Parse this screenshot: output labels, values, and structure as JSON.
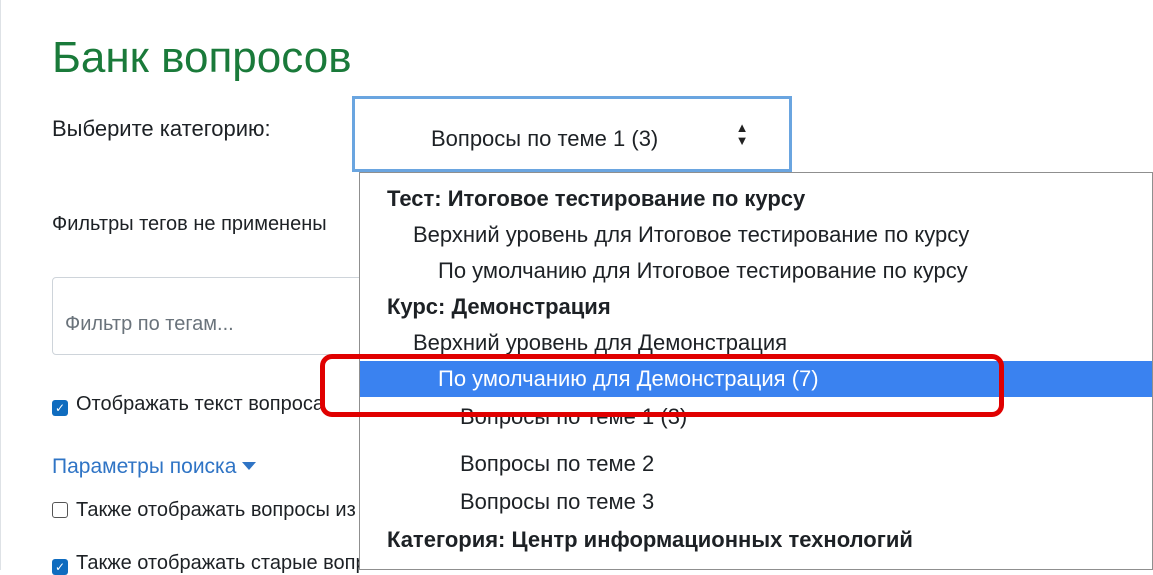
{
  "page": {
    "title": "Банк вопросов",
    "category_label": "Выберите категорию:",
    "category_select": {
      "value": "Вопросы по теме 1 (3)",
      "arrows_glyph": "⇕"
    },
    "tag_filters_note": "Фильтры тегов не применены",
    "tag_filter": {
      "placeholder": "Фильтр по тегам..."
    },
    "show_question_text": {
      "label": "Отображать текст вопроса",
      "checked": true
    },
    "search_options_link": "Параметры поиска",
    "also_show_subcategories": {
      "label": "Также отображать вопросы из подкатегорий",
      "checked": false
    },
    "also_show_old": {
      "label": "Также отображать старые вопросы",
      "checked": true
    }
  },
  "dropdown": {
    "options": [
      {
        "label": "Тест: Итоговое тестирование по курсу",
        "kind": "group"
      },
      {
        "label": "Верхний уровень для Итоговое тестирование по курсу",
        "kind": "option"
      },
      {
        "label": "По умолчанию для Итоговое тестирование по курсу",
        "kind": "option"
      },
      {
        "label": "Курс: Демонстрация",
        "kind": "group"
      },
      {
        "label": "Верхний уровень для Демонстрация",
        "kind": "option"
      },
      {
        "label": "По умолчанию для Демонстрация (7)",
        "kind": "option",
        "selected": true
      },
      {
        "label": "Вопросы по теме 1 (3)",
        "kind": "option"
      },
      {
        "label": "Вопросы по теме 2",
        "kind": "option"
      },
      {
        "label": "Вопросы по теме 3",
        "kind": "option"
      },
      {
        "label": "Категория: Центр информационных технологий",
        "kind": "group"
      }
    ]
  },
  "colors": {
    "title_green": "#1a7a3a",
    "link_blue": "#2f74c5",
    "selection_blue": "#3a82f0",
    "highlight_red": "#e00000"
  }
}
